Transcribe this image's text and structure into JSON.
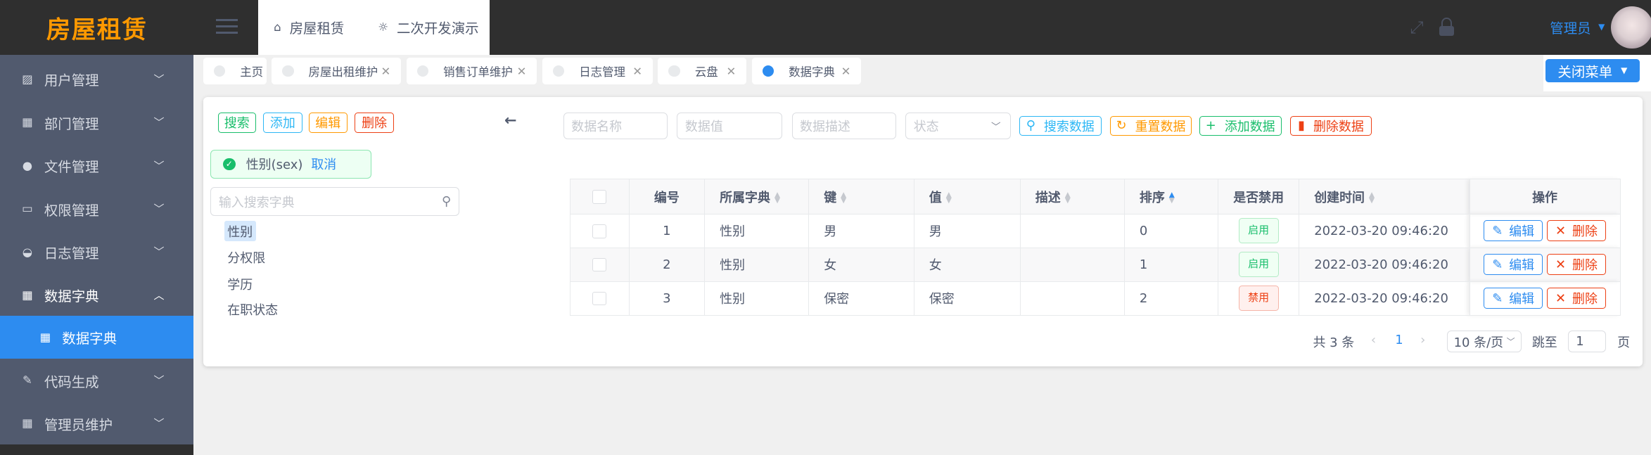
{
  "app": {
    "logo": "房屋租赁"
  },
  "topnav": {
    "items": [
      {
        "label": "房屋租赁",
        "icon": "home-icon"
      },
      {
        "label": "二次开发演示",
        "icon": "bulb-icon"
      }
    ]
  },
  "header": {
    "user": "管理员",
    "icons": [
      "fullscreen-icon",
      "lock-icon"
    ]
  },
  "sidebar": {
    "items": [
      {
        "label": "用户管理",
        "icon": "chart-icon"
      },
      {
        "label": "部门管理",
        "icon": "grid-icon"
      },
      {
        "label": "文件管理",
        "icon": "ball-icon"
      },
      {
        "label": "权限管理",
        "icon": "monitor-icon"
      },
      {
        "label": "日志管理",
        "icon": "gauge-icon"
      },
      {
        "label": "数据字典",
        "icon": "grid-icon"
      },
      {
        "label": "数据字典",
        "icon": "grid-icon"
      },
      {
        "label": "代码生成",
        "icon": "brush-icon"
      },
      {
        "label": "管理员维护",
        "icon": "grid-icon"
      }
    ]
  },
  "tabs": [
    {
      "label": "主页"
    },
    {
      "label": "房屋出租维护"
    },
    {
      "label": "销售订单维护"
    },
    {
      "label": "日志管理"
    },
    {
      "label": "云盘"
    },
    {
      "label": "数据字典",
      "active": true
    }
  ],
  "close_menu": "关闭菜单",
  "left": {
    "buttons": {
      "search": "搜索",
      "add": "添加",
      "edit": "编辑",
      "delete": "删除"
    },
    "selected": "性别(sex)",
    "cancel": "取消",
    "search_placeholder": "输入搜索字典",
    "tree": [
      "性别",
      "分权限",
      "学历",
      "在职状态"
    ]
  },
  "filters": {
    "name": "数据名称",
    "value": "数据值",
    "desc": "数据描述",
    "status": "状态",
    "search": "搜索数据",
    "reset": "重置数据",
    "add": "添加数据",
    "delete": "删除数据"
  },
  "table": {
    "headers": [
      "编号",
      "所属字典",
      "键",
      "值",
      "描述",
      "排序",
      "是否禁用",
      "创建时间",
      "操作"
    ],
    "rows": [
      {
        "id": "1",
        "dict": "性别",
        "key": "男",
        "value": "男",
        "desc": "",
        "sort": "0",
        "status": "启用",
        "created": "2022-03-20 09:46:20"
      },
      {
        "id": "2",
        "dict": "性别",
        "key": "女",
        "value": "女",
        "desc": "",
        "sort": "1",
        "status": "启用",
        "created": "2022-03-20 09:46:20"
      },
      {
        "id": "3",
        "dict": "性别",
        "key": "保密",
        "value": "保密",
        "desc": "",
        "sort": "2",
        "status": "禁用",
        "created": "2022-03-20 09:46:20"
      }
    ],
    "edit": "编辑",
    "delete": "删除"
  },
  "pagination": {
    "total": "共 3 条",
    "page": "1",
    "page_size": "10 条/页",
    "goto": "跳至",
    "goto_value": "1",
    "page_suffix": "页"
  },
  "colors": {
    "primary": "#2d8cf0",
    "success": "#19be6b",
    "warning": "#ff9900",
    "error": "#ed4014",
    "info": "#2db7f5",
    "sidebar": "#515a6e",
    "header": "#2f2f2f"
  }
}
